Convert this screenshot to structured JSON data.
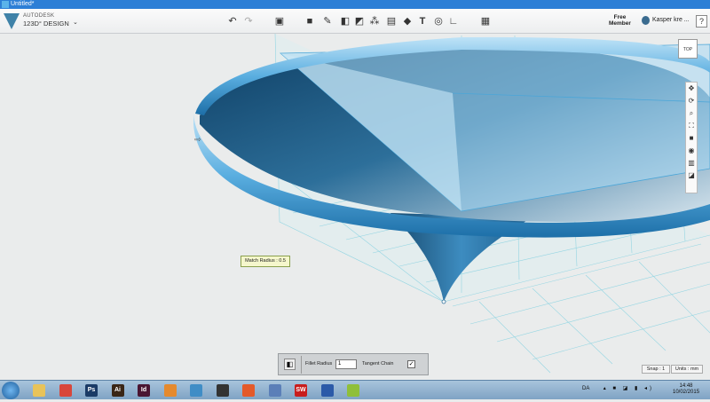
{
  "window": {
    "title": "Untitled*"
  },
  "brand": {
    "line1": "AUTODESK",
    "line2": "123D° DESIGN"
  },
  "toolbar": {
    "icons": [
      "undo-icon",
      "redo-icon",
      "transform-icon",
      "primitives-icon",
      "sketch-icon",
      "construct-icon",
      "modify-icon",
      "pattern-icon",
      "grouping-icon",
      "combine-icon",
      "text-icon",
      "snap-icon",
      "measure-icon",
      "material-icon"
    ]
  },
  "account": {
    "member_line1": "Free",
    "member_line2": "Member",
    "username": "Kasper kre ...",
    "help": "?"
  },
  "viewcube": {
    "label": "TOP"
  },
  "tooltip": {
    "text": "Match Radius : 0.5"
  },
  "fillet": {
    "radius_label": "Fillet Radius",
    "radius_value": "1",
    "tangent_label": "Tangent Chain",
    "tangent_checked": "✓"
  },
  "status": {
    "snap": "Snap : 1",
    "units": "Units : mm"
  },
  "taskbar": {
    "apps": [
      {
        "icon": "folder-icon",
        "label": "",
        "color": "#e8c35a"
      },
      {
        "icon": "chrome-icon",
        "label": "",
        "color": "#d8463b"
      },
      {
        "icon": "photoshop-icon",
        "label": "Ps",
        "color": "#1b3b66"
      },
      {
        "icon": "illustrator-icon",
        "label": "Ai",
        "color": "#3a2616"
      },
      {
        "icon": "indesign-icon",
        "label": "Id",
        "color": "#4a1532"
      },
      {
        "icon": "blender-icon",
        "label": "",
        "color": "#e58a2e"
      },
      {
        "icon": "123d-design-icon",
        "label": "",
        "color": "#3f8dc6"
      },
      {
        "icon": "inkscape-icon",
        "label": "",
        "color": "#333333"
      },
      {
        "icon": "sketchbook-icon",
        "label": "",
        "color": "#e45a2a"
      },
      {
        "icon": "virtualbox-icon",
        "label": "",
        "color": "#5b7fb8"
      },
      {
        "icon": "solidworks-icon",
        "label": "SW",
        "color": "#c81d1d"
      },
      {
        "icon": "settings-app-icon",
        "label": "",
        "color": "#2b5aa8"
      },
      {
        "icon": "notepad-icon",
        "label": "",
        "color": "#8fbf3a"
      }
    ],
    "language": "DA",
    "time": "14:48",
    "date": "10/02/2015"
  }
}
